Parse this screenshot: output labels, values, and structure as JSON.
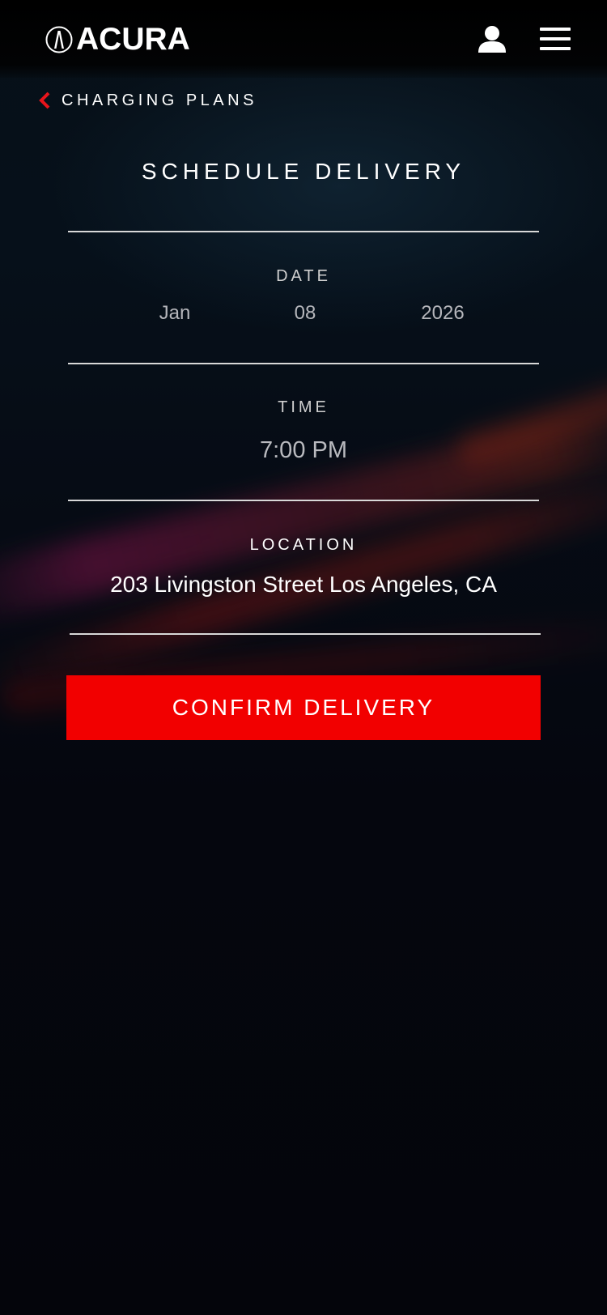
{
  "header": {
    "brand": "ACURA",
    "logo_icon": "acura-logo-icon",
    "account_icon": "user-icon",
    "menu_icon": "hamburger-menu-icon"
  },
  "back_link": {
    "label": "CHARGING PLANS",
    "icon": "chevron-left-icon",
    "icon_color": "#e8141b"
  },
  "page_title": "SCHEDULE DELIVERY",
  "date": {
    "label": "DATE",
    "month": "Jan",
    "day": "08",
    "year": "2026"
  },
  "time": {
    "label": "TIME",
    "value": "7:00 PM"
  },
  "location": {
    "label": "LOCATION",
    "value": "203 Livingston Street Los Angeles, CA"
  },
  "confirm_button": {
    "label": "CONFIRM DELIVERY",
    "color": "#f20000"
  }
}
